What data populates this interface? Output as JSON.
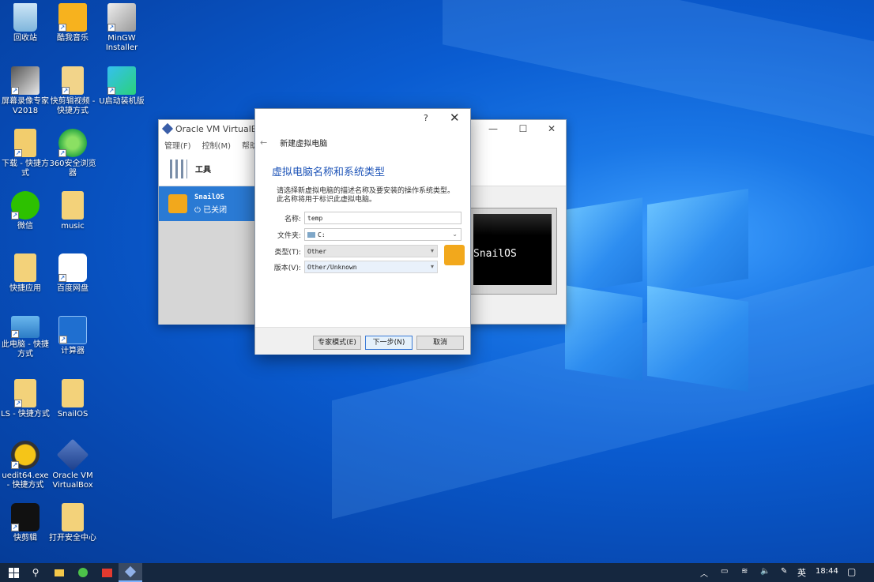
{
  "desktop_icons": [
    {
      "label": "回收站",
      "icon": "recycle-bin-icon"
    },
    {
      "label": "酷我音乐",
      "icon": "kuwo-music-icon"
    },
    {
      "label": "MinGW Installer",
      "icon": "mingw-installer-icon"
    },
    {
      "label": "屏幕录像专家 V2018",
      "icon": "screen-recorder-icon"
    },
    {
      "label": "快剪辑视频 - 快捷方式",
      "icon": "video-editor-shortcut-icon"
    },
    {
      "label": "U启动装机版",
      "icon": "u-start-icon"
    },
    {
      "label": "下载 - 快捷方式",
      "icon": "downloads-folder-icon"
    },
    {
      "label": "360安全浏览器",
      "icon": "360-browser-icon"
    },
    {
      "label": "微信",
      "icon": "wechat-icon"
    },
    {
      "label": "music",
      "icon": "music-folder-icon"
    },
    {
      "label": "快捷应用",
      "icon": "shortcut-apps-folder-icon"
    },
    {
      "label": "百度网盘",
      "icon": "baidu-netdisk-icon"
    },
    {
      "label": "此电脑 - 快捷方式",
      "icon": "this-pc-icon"
    },
    {
      "label": "计算器",
      "icon": "calculator-icon"
    },
    {
      "label": "LS - 快捷方式",
      "icon": "ls-folder-icon"
    },
    {
      "label": "SnailOS",
      "icon": "snailos-folder-icon"
    },
    {
      "label": "uedit64.exe - 快捷方式",
      "icon": "ultraedit-icon"
    },
    {
      "label": "Oracle VM VirtualBox",
      "icon": "virtualbox-icon"
    },
    {
      "label": "快剪辑",
      "icon": "kuaijianji-icon"
    },
    {
      "label": "打开安全中心",
      "icon": "security-center-icon"
    }
  ],
  "vbox": {
    "title": "Oracle VM VirtualBox",
    "menu": [
      "管理(F)",
      "控制(M)",
      "帮助("
    ],
    "tools_label": "工具",
    "vm_name": "SnailOS",
    "vm_state": "已关闭",
    "preview_text": "SnailOS"
  },
  "dialog": {
    "help_glyph": "?",
    "close_glyph": "✕",
    "back_glyph": "←",
    "subtitle": "新建虚拟电脑",
    "heading": "虚拟电脑名称和系统类型",
    "description": "请选择新虚拟电脑的描述名称及要安装的操作系统类型。此名称将用于标识此虚拟电脑。",
    "name_label": "名称:",
    "name_value": "temp",
    "folder_label": "文件夹:",
    "folder_value": "C:",
    "type_label": "类型(T):",
    "type_value": "Other",
    "version_label": "版本(V):",
    "version_value": "Other/Unknown",
    "buttons": {
      "expert": "专家模式(E)",
      "next": "下一步(N)",
      "cancel": "取消"
    }
  },
  "taskbar": {
    "language": "英",
    "time": "18:44"
  }
}
